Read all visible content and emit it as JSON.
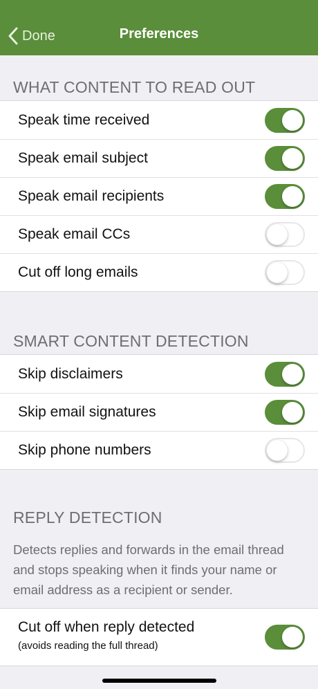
{
  "nav": {
    "back_label": "Done",
    "title": "Preferences",
    "bar_color": "#5a8e3a"
  },
  "sections": {
    "content": {
      "header": "WHAT CONTENT TO READ OUT",
      "rows": [
        {
          "label": "Speak time received",
          "on": true
        },
        {
          "label": "Speak email subject",
          "on": true
        },
        {
          "label": "Speak email recipients",
          "on": true
        },
        {
          "label": "Speak email CCs",
          "on": false
        },
        {
          "label": "Cut off long emails",
          "on": false
        }
      ]
    },
    "smart": {
      "header": "SMART CONTENT DETECTION",
      "rows": [
        {
          "label": "Skip disclaimers",
          "on": true
        },
        {
          "label": "Skip email signatures",
          "on": true
        },
        {
          "label": "Skip phone numbers",
          "on": false
        }
      ]
    },
    "reply": {
      "header": "REPLY DETECTION",
      "description": "Detects replies and forwards in the email thread and stops speaking when it finds your name or email address as a recipient or sender.",
      "row": {
        "label": "Cut off when reply detected",
        "sub": "(avoids reading the full thread)",
        "on": true
      }
    }
  },
  "colors": {
    "toggle_on": "#5a8e3a",
    "background": "#efeff4",
    "header_text": "#6d6d72"
  }
}
